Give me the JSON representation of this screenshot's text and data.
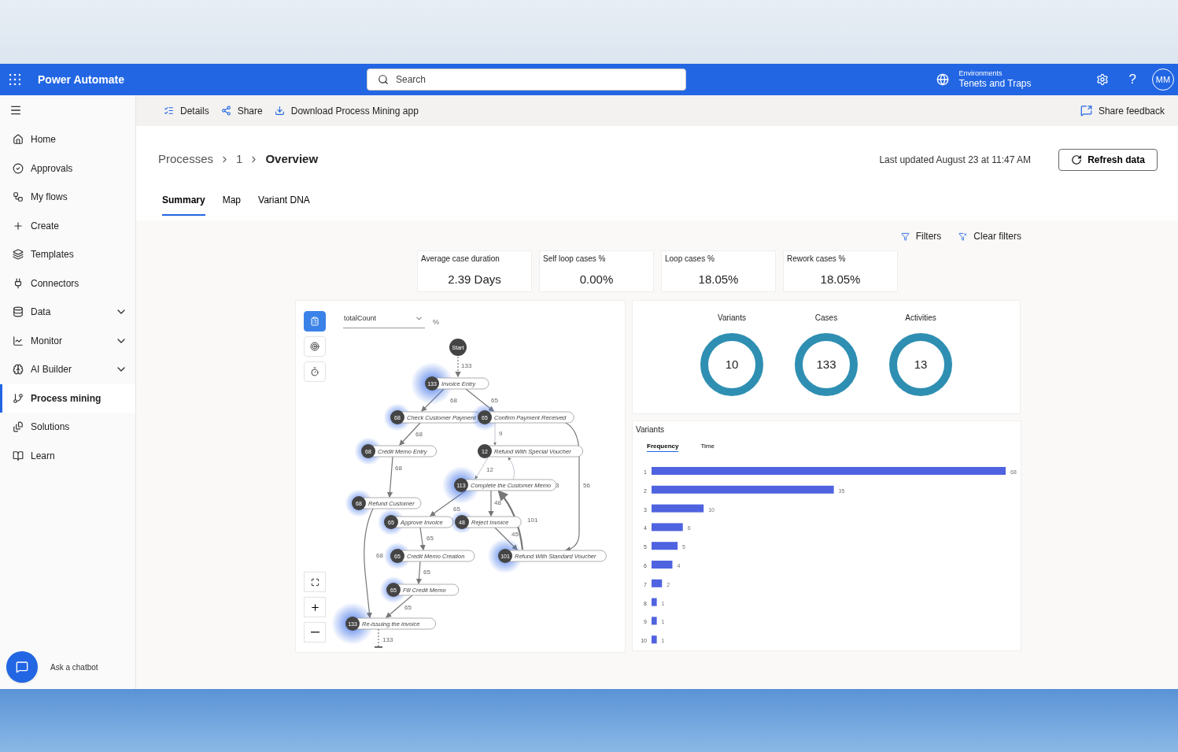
{
  "app": {
    "title": "Power Automate"
  },
  "search": {
    "placeholder": "Search"
  },
  "environment": {
    "label": "Environments",
    "name": "Tenets and Traps"
  },
  "header_actions": {
    "help": "?",
    "avatar": "MM"
  },
  "command_bar": {
    "items": [
      {
        "kind": "details",
        "label": "Details"
      },
      {
        "kind": "share",
        "label": "Share"
      },
      {
        "kind": "download",
        "label": "Download Process Mining app"
      }
    ],
    "feedback": "Share feedback"
  },
  "sidebar": {
    "items": [
      {
        "kind": "home",
        "label": "Home",
        "expandable": false,
        "selected": false
      },
      {
        "kind": "approvals",
        "label": "Approvals",
        "expandable": false,
        "selected": false
      },
      {
        "kind": "flows",
        "label": "My flows",
        "expandable": false,
        "selected": false
      },
      {
        "kind": "create",
        "label": "Create",
        "expandable": false,
        "selected": false
      },
      {
        "kind": "templates",
        "label": "Templates",
        "expandable": false,
        "selected": false
      },
      {
        "kind": "connectors",
        "label": "Connectors",
        "expandable": false,
        "selected": false
      },
      {
        "kind": "data",
        "label": "Data",
        "expandable": true,
        "selected": false
      },
      {
        "kind": "monitor",
        "label": "Monitor",
        "expandable": true,
        "selected": false
      },
      {
        "kind": "ai",
        "label": "AI Builder",
        "expandable": true,
        "selected": false
      },
      {
        "kind": "mining",
        "label": "Process mining",
        "expandable": false,
        "selected": true
      },
      {
        "kind": "solutions",
        "label": "Solutions",
        "expandable": false,
        "selected": false
      },
      {
        "kind": "learn",
        "label": "Learn",
        "expandable": false,
        "selected": false
      }
    ],
    "chatbot": "Ask a chatbot"
  },
  "breadcrumb": [
    "Processes",
    "1",
    "Overview"
  ],
  "last_updated": "Last updated August 23 at 11:47 AM",
  "refresh_button": "Refresh data",
  "tabs": [
    {
      "label": "Summary",
      "selected": true
    },
    {
      "label": "Map",
      "selected": false
    },
    {
      "label": "Variant DNA",
      "selected": false
    }
  ],
  "filters": {
    "filters": "Filters",
    "clear": "Clear filters"
  },
  "kpis": [
    {
      "label": "Average case duration",
      "value": "2.39 Days"
    },
    {
      "label": "Self loop cases %",
      "value": "0.00%"
    },
    {
      "label": "Loop cases %",
      "value": "18.05%"
    },
    {
      "label": "Rework cases %",
      "value": "18.05%"
    }
  ],
  "process_map": {
    "metric": "totalCount",
    "unit": "%",
    "tools": [
      {
        "kind": "frequency",
        "selected": true
      },
      {
        "kind": "performance",
        "selected": false
      },
      {
        "kind": "time",
        "selected": false
      }
    ],
    "nodes": [
      {
        "kind": "start",
        "label": "Start"
      },
      {
        "kind": "activity",
        "count": "133",
        "label": "Invoice Entry"
      },
      {
        "kind": "activity",
        "count": "68",
        "label": "Check Customer Payment"
      },
      {
        "kind": "activity",
        "count": "65",
        "label": "Confirm Payment Received"
      },
      {
        "kind": "activity",
        "count": "68",
        "label": "Credit Memo Entry"
      },
      {
        "kind": "activity",
        "count": "12",
        "label": "Refund With Special Voucher"
      },
      {
        "kind": "activity",
        "count": "113",
        "label": "Complete the Customer Memo"
      },
      {
        "kind": "activity",
        "count": "68",
        "label": "Refund Customer"
      },
      {
        "kind": "activity",
        "count": "65",
        "label": "Approve Invoice"
      },
      {
        "kind": "activity",
        "count": "48",
        "label": "Reject Invoice"
      },
      {
        "kind": "activity",
        "count": "65",
        "label": "Credit Memo Creation"
      },
      {
        "kind": "activity",
        "count": "101",
        "label": "Refund With Standard Voucher"
      },
      {
        "kind": "activity",
        "count": "65",
        "label": "Fill Credit Memo"
      },
      {
        "kind": "activity",
        "count": "133",
        "label": "Re-issuing the invoice"
      }
    ],
    "edges": [
      "133",
      "68",
      "65",
      "68",
      "9",
      "56",
      "12",
      "3",
      "68",
      "65",
      "48",
      "101",
      "45",
      "68",
      "65",
      "65",
      "65",
      "133"
    ]
  },
  "summary": [
    {
      "label": "Variants",
      "value": "10"
    },
    {
      "label": "Cases",
      "value": "133"
    },
    {
      "label": "Activities",
      "value": "13"
    }
  ],
  "variants": {
    "title": "Variants",
    "tabs": [
      {
        "label": "Frequency",
        "selected": true
      },
      {
        "label": "Time",
        "selected": false
      }
    ],
    "chart_data": {
      "type": "bar",
      "orientation": "horizontal",
      "categories": [
        "1",
        "2",
        "3",
        "4",
        "5",
        "6",
        "7",
        "8",
        "9",
        "10"
      ],
      "series": [
        {
          "color": "#4f63e0",
          "values": [
            68,
            35,
            10,
            6,
            5,
            4,
            2,
            1,
            1,
            1
          ]
        }
      ],
      "data_labels": true
    }
  }
}
